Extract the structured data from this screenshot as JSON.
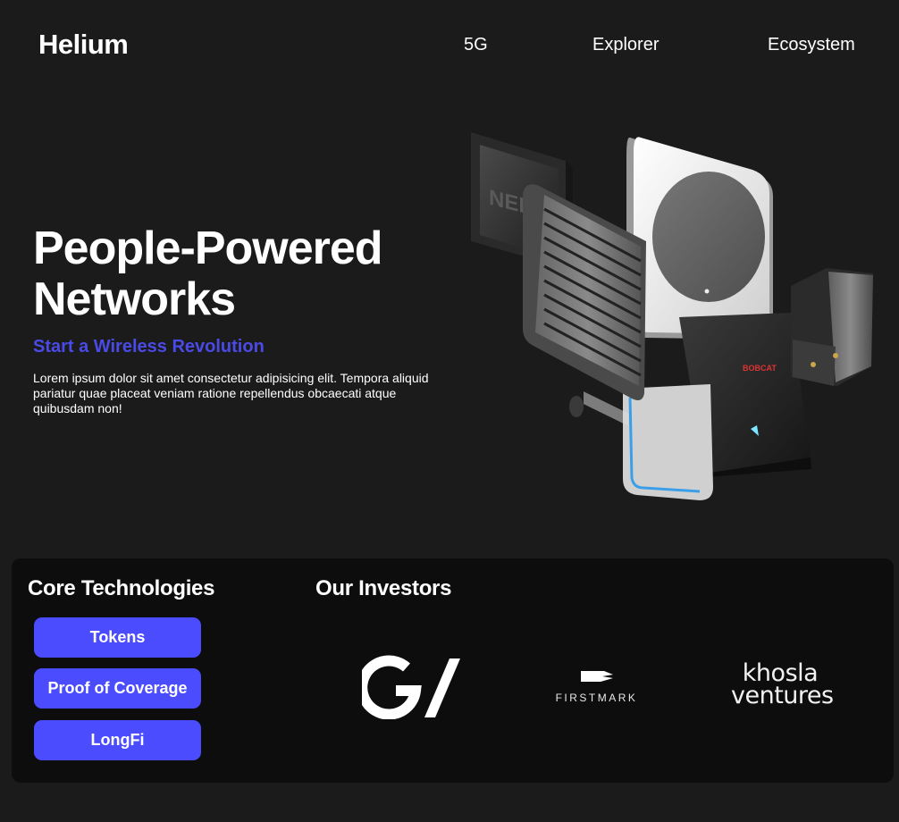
{
  "header": {
    "logo": "Helium",
    "nav": [
      "5G",
      "Explorer",
      "Ecosystem"
    ]
  },
  "hero": {
    "title_line1": "People-Powered",
    "title_line2": "Networks",
    "subtitle": "Start a Wireless Revolution",
    "body": "Lorem ipsum dolor sit amet consectetur adipisicing elit. Tempora aliquid pariatur quae placeat veniam ratione repellendus obcaecati atque quibusdam non!",
    "image_labels": {
      "hotspot_brand": "NEBRA",
      "bobcat": "BOBCAT"
    }
  },
  "core": {
    "heading": "Core Technologies",
    "buttons": [
      "Tokens",
      "Proof of Coverage",
      "LongFi"
    ]
  },
  "investors": {
    "heading": "Our Investors",
    "logos": [
      {
        "name": "GV",
        "icon": "gv-logo"
      },
      {
        "name": "FIRSTMARK",
        "icon": "firstmark-logo"
      },
      {
        "name_line1": "khosla",
        "name_line2": "ventures",
        "icon": "khosla-ventures-logo"
      }
    ]
  },
  "colors": {
    "background": "#1b1b1b",
    "panel": "#0d0d0d",
    "accent": "#4c4cff",
    "subtitle": "#4a4ae6"
  }
}
